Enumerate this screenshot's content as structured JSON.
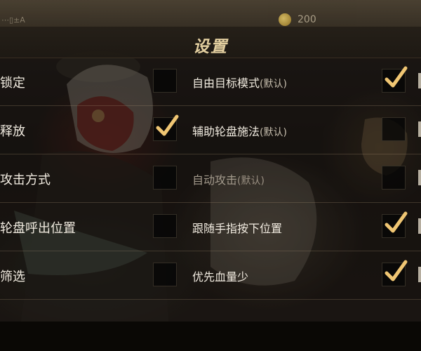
{
  "topbar": {
    "left_text": "⋯▯±A",
    "coin_icon": "coin-icon",
    "coin_value": "200"
  },
  "panel": {
    "title": "设置"
  },
  "rows": [
    {
      "left_label": "锁定",
      "left_checked": false,
      "right_label": "自由目标模式",
      "right_hint": "(默认)",
      "right_checked": true,
      "right_dimmed": false
    },
    {
      "left_label": "释放",
      "left_checked": true,
      "right_label": "辅助轮盘施法",
      "right_hint": "(默认)",
      "right_checked": false,
      "right_dimmed": false
    },
    {
      "left_label": "攻击方式",
      "left_checked": false,
      "right_label": "自动攻击",
      "right_hint": "(默认)",
      "right_checked": false,
      "right_dimmed": true
    },
    {
      "left_label": "轮盘呼出位置",
      "left_checked": false,
      "right_label": "跟随手指按下位置",
      "right_hint": "",
      "right_checked": true,
      "right_dimmed": false
    },
    {
      "left_label": "筛选",
      "left_checked": false,
      "right_label": "优先血量少",
      "right_hint": "",
      "right_checked": true,
      "right_dimmed": false
    }
  ],
  "colors": {
    "check": "#f0c673",
    "title": "#e3cfa0",
    "label": "#f1ebe0"
  },
  "icons": {
    "check": "check-icon"
  }
}
